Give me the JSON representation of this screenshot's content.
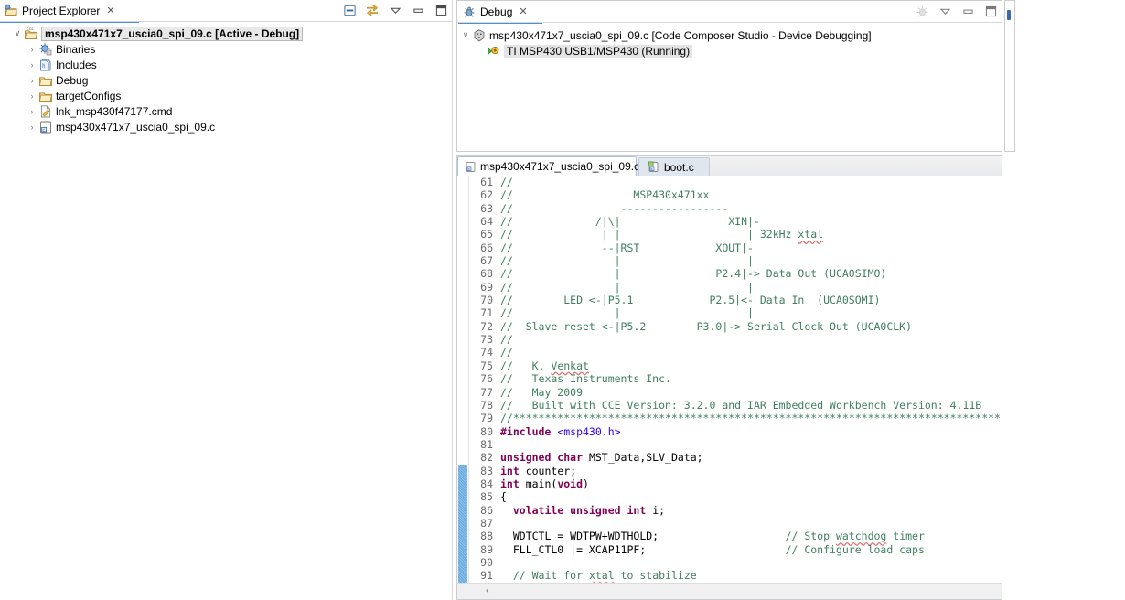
{
  "project_explorer": {
    "tab_label": "Project Explorer",
    "close_glyph": "✕",
    "tools": [
      {
        "name": "collapse-all-icon",
        "glyph": "▤"
      },
      {
        "name": "link-with-editor-icon",
        "glyph": "⇄"
      },
      {
        "name": "view-menu-icon",
        "glyph": "▽"
      },
      {
        "name": "minimize-icon",
        "glyph": "▭"
      },
      {
        "name": "maximize-icon",
        "glyph": "❏"
      }
    ],
    "tree": [
      {
        "label": "msp430x471x7_uscia0_spi_09.c  [Active - Debug]",
        "twist": "v",
        "icon": "ccs-project-icon",
        "indent": 0,
        "bold": true,
        "selected": true
      },
      {
        "label": "Binaries",
        "twist": ">",
        "icon": "binaries-icon",
        "indent": 1,
        "bold": false,
        "selected": false
      },
      {
        "label": "Includes",
        "twist": ">",
        "icon": "includes-icon",
        "indent": 1,
        "bold": false,
        "selected": false
      },
      {
        "label": "Debug",
        "twist": ">",
        "icon": "folder-icon",
        "indent": 1,
        "bold": false,
        "selected": false
      },
      {
        "label": "targetConfigs",
        "twist": ">",
        "icon": "folder-icon",
        "indent": 1,
        "bold": false,
        "selected": false
      },
      {
        "label": "lnk_msp430f47177.cmd",
        "twist": ">",
        "icon": "cmd-file-icon",
        "indent": 1,
        "bold": false,
        "selected": false
      },
      {
        "label": "msp430x471x7_uscia0_spi_09.c",
        "twist": ">",
        "icon": "c-file-icon",
        "indent": 1,
        "bold": false,
        "selected": false
      }
    ]
  },
  "debug_view": {
    "tab_label": "Debug",
    "close_glyph": "✕",
    "tools": [
      {
        "name": "debug-view-menu-disabled-icon",
        "glyph": "✳"
      },
      {
        "name": "view-menu-icon",
        "glyph": "▽"
      },
      {
        "name": "minimize-icon",
        "glyph": "▭"
      },
      {
        "name": "maximize-icon",
        "glyph": "❏"
      }
    ],
    "tree": [
      {
        "label": "msp430x471x7_uscia0_spi_09.c [Code Composer Studio - Device Debugging]",
        "twist": "v",
        "icon": "debug-launch-icon",
        "indent": 0,
        "selected": false
      },
      {
        "label": "TI MSP430 USB1/MSP430 (Running)",
        "twist": "",
        "icon": "debug-thread-icon",
        "indent": 1,
        "selected": true
      }
    ]
  },
  "editor": {
    "tabs": [
      {
        "label": "msp430x471x7_uscia0_spi_09.c",
        "icon": "c-file-icon",
        "active": true,
        "close_glyph": "✕"
      },
      {
        "label": "boot.c",
        "icon": "c-file-active-icon",
        "active": false,
        "close_glyph": ""
      }
    ],
    "scroll_left_glyph": "‹",
    "change_bar_from_line": 83,
    "change_bar_to_line": 91,
    "first_line_number": 61,
    "lines": [
      {
        "n": 61,
        "tokens": [
          {
            "t": "//",
            "c": "cmt"
          }
        ]
      },
      {
        "n": 62,
        "tokens": [
          {
            "t": "//                   MSP430x471xx",
            "c": "cmt"
          }
        ]
      },
      {
        "n": 63,
        "tokens": [
          {
            "t": "//                 -----------------",
            "c": "cmt"
          }
        ]
      },
      {
        "n": 64,
        "tokens": [
          {
            "t": "//             /|\\|                 XIN|-",
            "c": "cmt"
          }
        ]
      },
      {
        "n": 65,
        "tokens": [
          {
            "t": "//              | |                    | 32kHz ",
            "c": "cmt"
          },
          {
            "t": "xtal",
            "c": "cmt sq"
          }
        ]
      },
      {
        "n": 66,
        "tokens": [
          {
            "t": "//              --|RST            XOUT|-",
            "c": "cmt"
          }
        ]
      },
      {
        "n": 67,
        "tokens": [
          {
            "t": "//                |                    |",
            "c": "cmt"
          }
        ]
      },
      {
        "n": 68,
        "tokens": [
          {
            "t": "//                |               P2.4|-> Data Out (UCA0SIMO)",
            "c": "cmt"
          }
        ]
      },
      {
        "n": 69,
        "tokens": [
          {
            "t": "//                |                    |",
            "c": "cmt"
          }
        ]
      },
      {
        "n": 70,
        "tokens": [
          {
            "t": "//        LED <-|P5.1            P2.5|<- Data In  (UCA0SOMI)",
            "c": "cmt"
          }
        ]
      },
      {
        "n": 71,
        "tokens": [
          {
            "t": "//                |                    |",
            "c": "cmt"
          }
        ]
      },
      {
        "n": 72,
        "tokens": [
          {
            "t": "//  Slave reset <-|P5.2        P3.0|-> Serial Clock Out (UCA0CLK)",
            "c": "cmt"
          }
        ]
      },
      {
        "n": 73,
        "tokens": [
          {
            "t": "//",
            "c": "cmt"
          }
        ]
      },
      {
        "n": 74,
        "tokens": [
          {
            "t": "//",
            "c": "cmt"
          }
        ]
      },
      {
        "n": 75,
        "tokens": [
          {
            "t": "//   K. ",
            "c": "cmt"
          },
          {
            "t": "Venkat",
            "c": "cmt sq"
          }
        ]
      },
      {
        "n": 76,
        "tokens": [
          {
            "t": "//   Texas Instruments Inc.",
            "c": "cmt"
          }
        ]
      },
      {
        "n": 77,
        "tokens": [
          {
            "t": "//   May 2009",
            "c": "cmt"
          }
        ]
      },
      {
        "n": 78,
        "tokens": [
          {
            "t": "//   Built with CCE Version: 3.2.0 and IAR Embedded Workbench Version: 4.11B",
            "c": "cmt"
          }
        ]
      },
      {
        "n": 79,
        "tokens": [
          {
            "t": "//******************************************************************************",
            "c": "cmt"
          }
        ]
      },
      {
        "n": 80,
        "tokens": [
          {
            "t": "#include ",
            "c": "pre"
          },
          {
            "t": "<msp430.h>",
            "c": "str"
          }
        ]
      },
      {
        "n": 81,
        "tokens": []
      },
      {
        "n": 82,
        "tokens": [
          {
            "t": "unsigned char ",
            "c": "kw"
          },
          {
            "t": "MST_Data,SLV_Data;",
            "c": "pln"
          }
        ]
      },
      {
        "n": 83,
        "tokens": [
          {
            "t": "int ",
            "c": "kw"
          },
          {
            "t": "counter;",
            "c": "pln"
          }
        ]
      },
      {
        "n": 84,
        "tokens": [
          {
            "t": "int ",
            "c": "kw"
          },
          {
            "t": "main(",
            "c": "pln"
          },
          {
            "t": "void",
            "c": "kw"
          },
          {
            "t": ")",
            "c": "pln"
          }
        ]
      },
      {
        "n": 85,
        "tokens": [
          {
            "t": "{",
            "c": "pln"
          }
        ]
      },
      {
        "n": 86,
        "tokens": [
          {
            "t": "  ",
            "c": "pln"
          },
          {
            "t": "volatile unsigned int ",
            "c": "kw"
          },
          {
            "t": "i;",
            "c": "pln"
          }
        ]
      },
      {
        "n": 87,
        "tokens": []
      },
      {
        "n": 88,
        "tokens": [
          {
            "t": "  WDTCTL = WDTPW+WDTHOLD;                    ",
            "c": "pln"
          },
          {
            "t": "// Stop ",
            "c": "cmt"
          },
          {
            "t": "watchdog",
            "c": "cmt sq"
          },
          {
            "t": " timer",
            "c": "cmt"
          }
        ]
      },
      {
        "n": 89,
        "tokens": [
          {
            "t": "  FLL_CTL0 |= XCAP11PF;                      ",
            "c": "pln"
          },
          {
            "t": "// Configure load caps",
            "c": "cmt"
          }
        ]
      },
      {
        "n": 90,
        "tokens": []
      },
      {
        "n": 91,
        "tokens": [
          {
            "t": "  ",
            "c": "pln"
          },
          {
            "t": "// Wait for ",
            "c": "cmt"
          },
          {
            "t": "xtal",
            "c": "cmt sq"
          },
          {
            "t": " to stabilize",
            "c": "cmt"
          }
        ]
      }
    ]
  },
  "colors": {
    "tab_underline": "#4a90d9",
    "comment": "#3f7f5f",
    "keyword": "#7f0055",
    "string": "#2a00ff",
    "change_bar": "#67a9e0",
    "selection_gray": "#e4e4e4"
  }
}
